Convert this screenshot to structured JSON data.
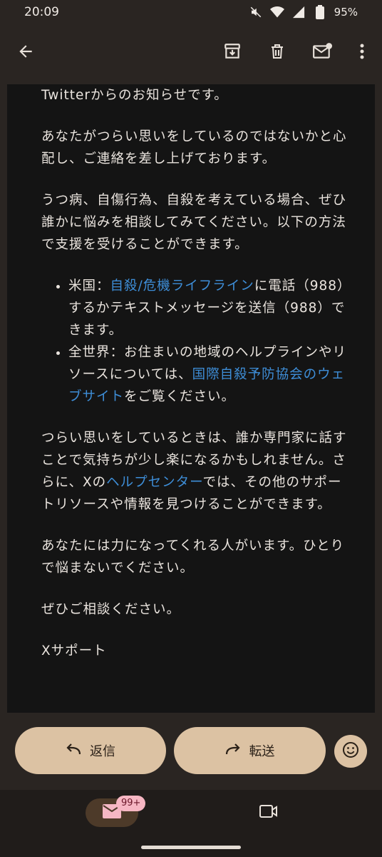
{
  "status_bar": {
    "time": "20:09",
    "battery": "95%",
    "icons": [
      "mute-icon",
      "wifi-icon",
      "signal-icon",
      "battery-icon"
    ]
  },
  "toolbar": {
    "icons": [
      "back-arrow-icon",
      "archive-icon",
      "delete-icon",
      "mark-unread-icon",
      "more-vert-icon"
    ]
  },
  "email": {
    "p1": "Twitterからのお知らせです。",
    "p2": "あなたがつらい思いをしているのではないかと心配し、ご連絡を差し上げております。",
    "p3": "うつ病、自傷行為、自殺を考えている場合、ぜひ誰かに悩みを相談してみてください。以下の方法で支援を受けることができます。",
    "bullet1": {
      "prefix": "米国：",
      "link": "自殺/危機ライフライン",
      "suffix": "に電話（988）するかテキストメッセージを送信（988）できます。"
    },
    "bullet2": {
      "prefix": "全世界：お住まいの地域のヘルプラインやリソースについては、",
      "link": "国際自殺予防協会のウェブサイト",
      "suffix": "をご覧ください。"
    },
    "p4": {
      "prefix": "つらい思いをしているときは、誰か専門家に話すことで気持ちが少し楽になるかもしれません。さらに、Xの",
      "link": "ヘルプセンター",
      "suffix": "では、その他のサポートリソースや情報を見つけることができます。"
    },
    "p5": "あなたには力になってくれる人がいます。ひとりで悩まないでください。",
    "p6": "ぜひご相談ください。",
    "signature": "Xサポート"
  },
  "actions": {
    "reply_label": "返信",
    "forward_label": "転送"
  },
  "bottom_nav": {
    "mail_badge": "99+"
  },
  "colors": {
    "link": "#3e8ed8",
    "pill": "#dcc2a3",
    "badge": "#f6b6c3"
  }
}
